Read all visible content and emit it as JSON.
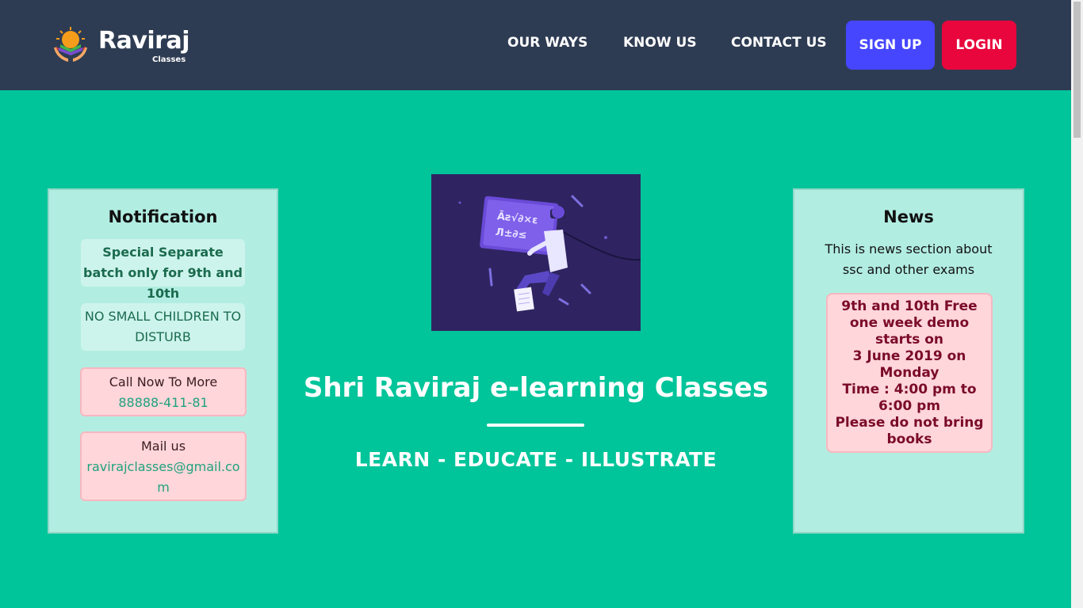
{
  "header": {
    "logo_text": "Raviraj",
    "logo_sub": "Classes",
    "nav": [
      "OUR WAYS",
      "KNOW US",
      "CONTACT US"
    ],
    "signup_label": "SIGN UP",
    "login_label": "LOGIN"
  },
  "notification": {
    "title": "Notification",
    "items": [
      {
        "text": "Special Separate batch only for 9th and 10th"
      },
      {
        "text": "NO SMALL CHILDREN TO DISTURB"
      },
      {
        "text": "Call Now To More",
        "sub": "88888-411-81"
      },
      {
        "text": "Mail us",
        "sub": "ravirajclasses@gmail.com"
      }
    ]
  },
  "hero": {
    "title": "Shri Raviraj e-learning Classes",
    "tagline": "LEARN - EDUCATE - ILLUSTRATE"
  },
  "news": {
    "title": "News",
    "description": "This is news section about ssc and other exams",
    "announcement": "9th and 10th Free\none week demo\nstarts on\n3 June 2019 on\nMonday\nTime : 4:00 pm to\n6:00 pm\nPlease do not bring\nbooks"
  },
  "colors": {
    "header_bg": "#2e3c53",
    "page_bg": "#00c49a",
    "signup_bg": "#4646ff",
    "login_bg": "#e8063c"
  }
}
